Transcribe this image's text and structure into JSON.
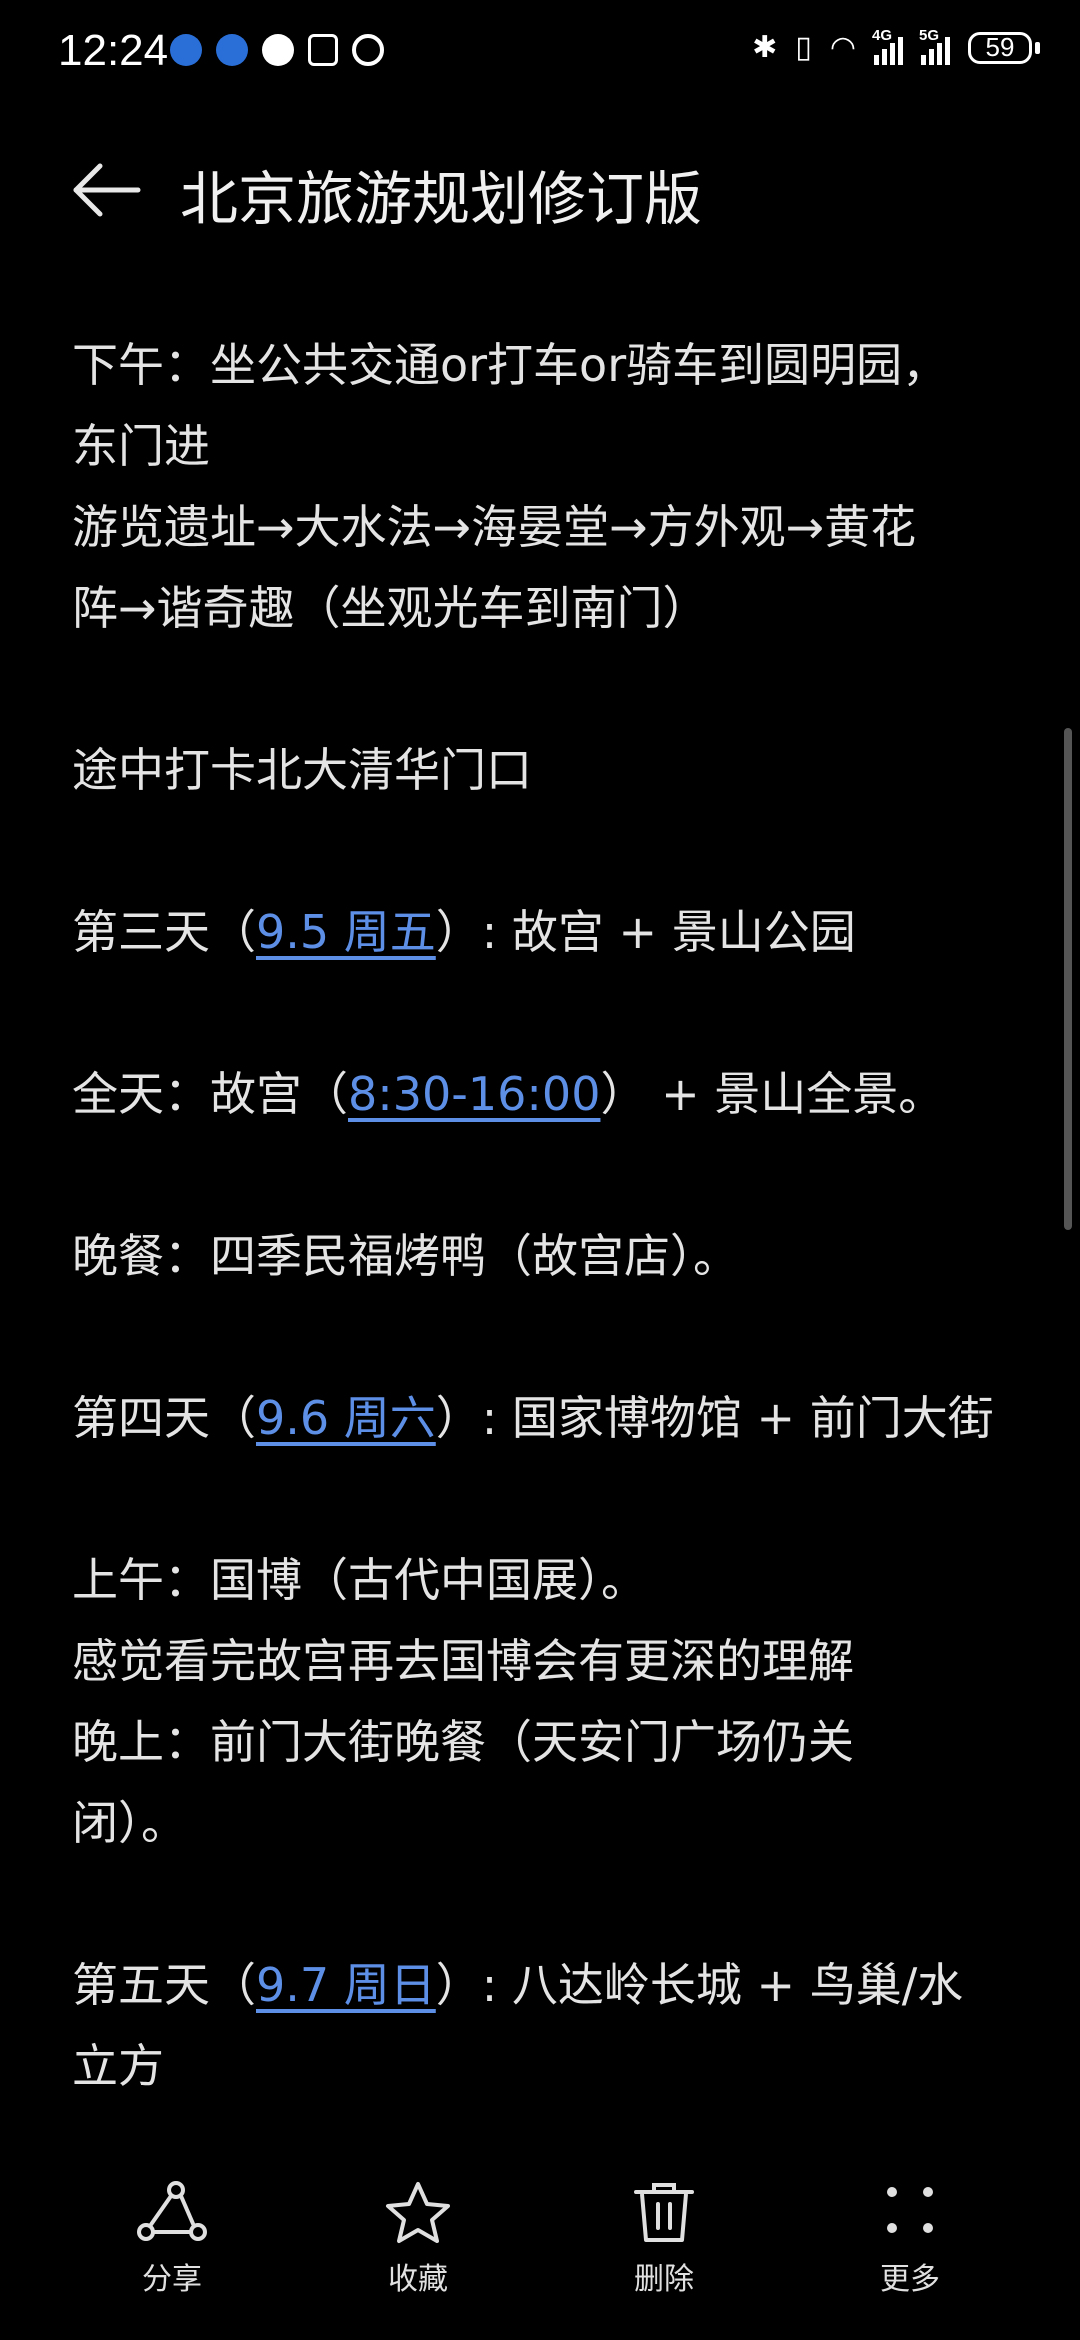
{
  "status_bar": {
    "time": "12:24",
    "network_4g": "4G",
    "network_5g": "5G",
    "battery": "59"
  },
  "header": {
    "title": "北京旅游规划修订版"
  },
  "content": {
    "afternoon_line1": "下午：坐公共交通or打车or骑车到圆明园，",
    "afternoon_line2": "东门进",
    "route_line1": "游览遗址→大水法→海晏堂→方外观→黄花",
    "route_line2": "阵→谐奇趣（坐观光车到南门）",
    "checkin": "途中打卡北大清华门口",
    "day3": {
      "prefix": "第三天（",
      "date_link": "9.5 周五",
      "suffix": "）: 故宫 + 景山公园"
    },
    "day3_allday": {
      "prefix": "全天：故宫（",
      "time_link": "8:30-16:00",
      "suffix": "） + 景山全景。"
    },
    "day3_dinner": "晚餐：四季民福烤鸭（故宫店）。",
    "day4": {
      "prefix": "第四天（",
      "date_link": "9.6 周六",
      "suffix": "）: 国家博物馆 + 前门大街"
    },
    "day4_morning": "上午：国博（古代中国展）。",
    "day4_note": "感觉看完故宫再去国博会有更深的理解",
    "day4_evening_line1": "晚上：前门大街晚餐（天安门广场仍关",
    "day4_evening_line2": "闭）。",
    "day5": {
      "prefix": "第五天（",
      "date_link": "9.7 周日",
      "suffix_line1": "）: 八达岭长城 + 鸟巢/水",
      "suffix_line2": "立方"
    }
  },
  "toolbar": {
    "share_label": "分享",
    "favorite_label": "收藏",
    "delete_label": "删除",
    "more_label": "更多"
  },
  "colors": {
    "background": "#000000",
    "text": "#e4e4e4",
    "link": "#5d8fe6"
  }
}
